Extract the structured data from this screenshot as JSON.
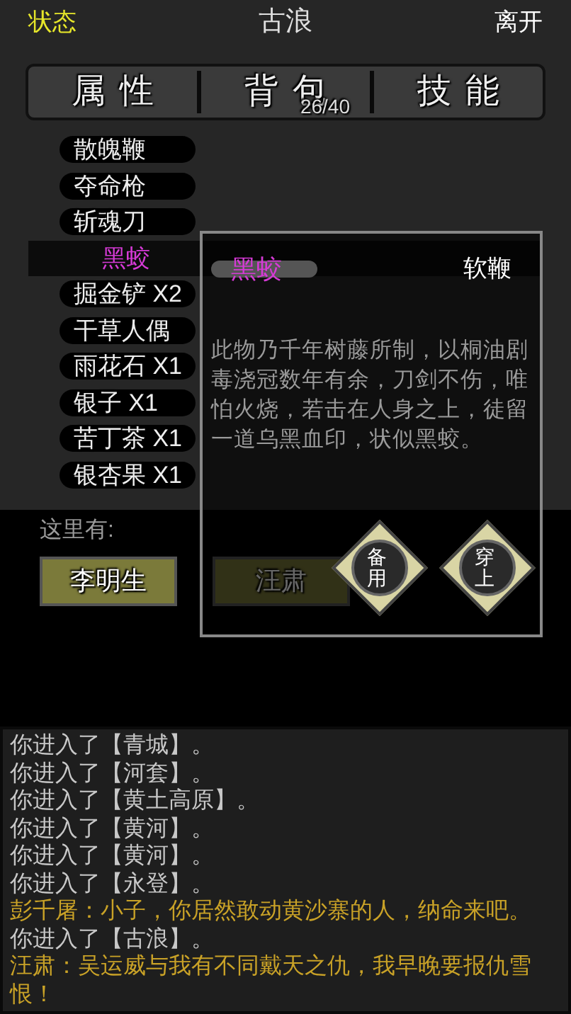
{
  "header": {
    "status": "状态",
    "title": "古浪",
    "leave": "离开"
  },
  "tabs": [
    {
      "label": "属性"
    },
    {
      "label": "背包",
      "count": "26/40"
    },
    {
      "label": "技能"
    }
  ],
  "items": [
    {
      "name": "散魄鞭",
      "selected": false
    },
    {
      "name": "夺命枪",
      "selected": false
    },
    {
      "name": "斩魂刀",
      "selected": false
    },
    {
      "name": "黑蛟",
      "selected": true
    },
    {
      "name": "掘金铲 X2",
      "selected": false
    },
    {
      "name": "干草人偶",
      "selected": false
    },
    {
      "name": "雨花石 X1",
      "selected": false
    },
    {
      "name": "银子 X1",
      "selected": false
    },
    {
      "name": "苦丁茶 X1",
      "selected": false
    },
    {
      "name": "银杏果 X1",
      "selected": false
    }
  ],
  "popup": {
    "name": "黑蛟",
    "type": "软鞭",
    "description": "此物乃千年树藤所制，以桐油剧毒浇冠数年有余，刀剑不伤，唯怕火烧，若击在人身之上，徒留一道乌黑血印，状似黑蛟。",
    "buttons": [
      "备用",
      "穿上"
    ]
  },
  "here": {
    "label": "这里有:",
    "npcs": [
      "李明生",
      "汪肃"
    ]
  },
  "log": [
    {
      "kind": "system",
      "text": "你进入了【青城】。"
    },
    {
      "kind": "system",
      "text": "你进入了【河套】。"
    },
    {
      "kind": "system",
      "text": "你进入了【黄土高原】。"
    },
    {
      "kind": "system",
      "text": "你进入了【黄河】。"
    },
    {
      "kind": "system",
      "text": "你进入了【黄河】。"
    },
    {
      "kind": "system",
      "text": "你进入了【永登】。"
    },
    {
      "kind": "speech",
      "text": "彭千屠：小子，你居然敢动黄沙寨的人，纳命来吧。"
    },
    {
      "kind": "system",
      "text": "你进入了【古浪】。"
    },
    {
      "kind": "speech",
      "text": "汪肃：吴运威与我有不同戴天之仇，我早晚要报仇雪恨！"
    }
  ]
}
